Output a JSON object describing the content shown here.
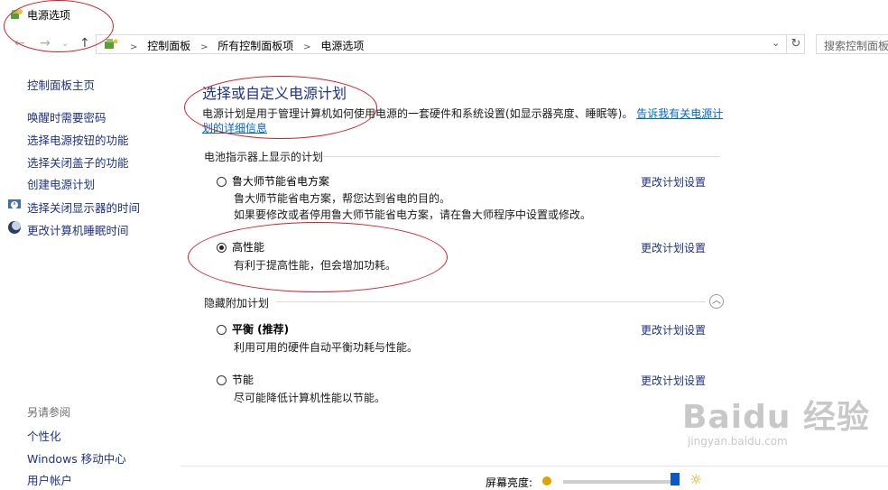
{
  "window": {
    "title": "电源选项"
  },
  "address": {
    "breadcrumbs": [
      "控制面板",
      "所有控制面板项",
      "电源选项"
    ],
    "search_placeholder": "搜索控制面板"
  },
  "sidebar": {
    "home": "控制面板主页",
    "links": [
      "唤醒时需要密码",
      "选择电源按钮的功能",
      "选择关闭盖子的功能",
      "创建电源计划",
      "选择关闭显示器的时间",
      "更改计算机睡眠时间"
    ],
    "see_also_label": "另请参阅",
    "see_also": [
      "个性化",
      "Windows 移动中心",
      "用户帐户"
    ]
  },
  "main": {
    "heading": "选择或自定义电源计划",
    "description": "电源计划是用于管理计算机如何使用电源的一套硬件和系统设置(如显示器亮度、睡眠等)。",
    "description_link": "告诉我有关电源计划的详细信息",
    "battery_section": "电池指示器上显示的计划",
    "hidden_section": "隐藏附加计划",
    "change_label": "更改计划设置",
    "plans": [
      {
        "name": "鲁大师节能省电方案",
        "desc1": "鲁大师节能省电方案，帮您达到省电的目的。",
        "desc2": "如果要修改或者停用鲁大师节能省电方案，请在鲁大师程序中设置或修改。",
        "selected": false
      },
      {
        "name": "高性能",
        "desc1": "有利于提高性能，但会增加功耗。",
        "selected": true
      },
      {
        "name": "平衡 (推荐)",
        "desc1": "利用可用的硬件自动平衡功耗与性能。",
        "selected": false
      },
      {
        "name": "节能",
        "desc1": "尽可能降低计算机性能以节能。",
        "selected": false
      }
    ]
  },
  "footer": {
    "brightness_label": "屏幕亮度:",
    "brightness_level": 1.0
  },
  "watermark": {
    "brand": "Baidu 经验",
    "url": "jingyan.baidu.com"
  },
  "colors": {
    "link": "#1e3287",
    "accent": "#0066cc",
    "annotation": "#d21f2b"
  }
}
